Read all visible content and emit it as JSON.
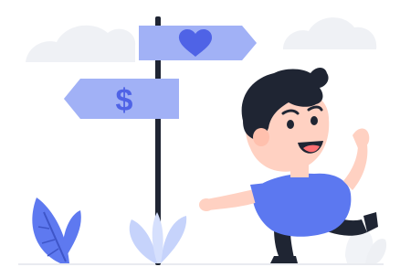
{
  "scene": {
    "description_icons": [
      "cloud-icon",
      "signpost-icon",
      "heart-icon",
      "dollar-icon",
      "leaf-icon",
      "plant-icon",
      "person-illustration"
    ],
    "colors": {
      "sign_blue": "#8ea1f3",
      "sign_blue_light": "#b9c6fb",
      "icon_blue": "#4f63e6",
      "pole": "#1f2533",
      "cloud": "#eff1f5",
      "hair": "#1f2533",
      "skin": "#ffd1c2",
      "shirt": "#5c78f0",
      "shoe": "#1f2533",
      "leaf_blue": "#5e79f0",
      "plant_light": "#c6d3fb",
      "ground": "#e9ebf0"
    }
  },
  "signs": {
    "top_symbol": "heart",
    "bottom_symbol": "$"
  }
}
